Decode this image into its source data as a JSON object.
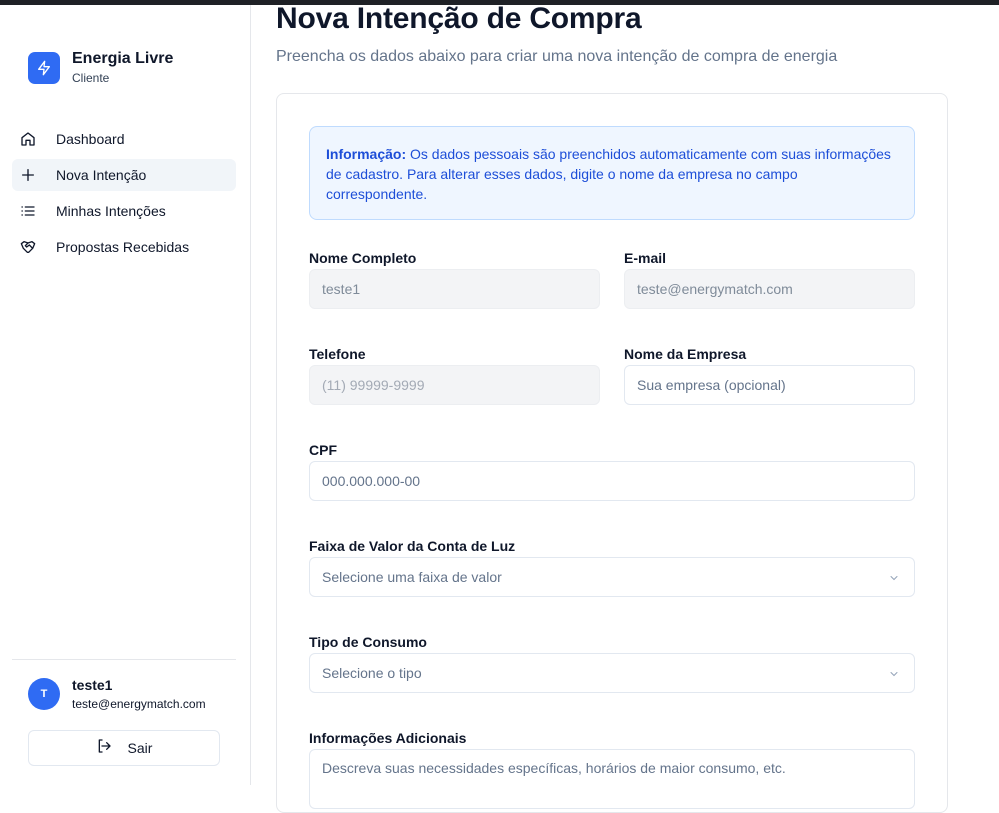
{
  "brand": {
    "name": "Energia Livre",
    "role": "Cliente",
    "logo_icon": "lightning-bolt-icon",
    "accent": "#2f6bf3"
  },
  "nav": {
    "items": [
      {
        "label": "Dashboard",
        "icon": "home-icon",
        "active": false
      },
      {
        "label": "Nova Intenção",
        "icon": "plus-icon",
        "active": true
      },
      {
        "label": "Minhas Intenções",
        "icon": "list-icon",
        "active": false
      },
      {
        "label": "Propostas Recebidas",
        "icon": "handshake-icon",
        "active": false
      }
    ]
  },
  "user": {
    "initial": "T",
    "name": "teste1",
    "email": "teste@energymatch.com",
    "logout_label": "Sair"
  },
  "page": {
    "title": "Nova Intenção de Compra",
    "subtitle": "Preencha os dados abaixo para criar uma nova intenção de compra de energia"
  },
  "info": {
    "label": "Informação:",
    "text": " Os dados pessoais são preenchidos automaticamente com suas informações de cadastro. Para alterar esses dados, digite o nome da empresa no campo correspondente."
  },
  "form": {
    "nome": {
      "label": "Nome Completo",
      "value": "teste1"
    },
    "email": {
      "label": "E-mail",
      "value": "teste@energymatch.com"
    },
    "telefone": {
      "label": "Telefone",
      "placeholder": "(11) 99999-9999"
    },
    "empresa": {
      "label": "Nome da Empresa",
      "placeholder": "Sua empresa (opcional)"
    },
    "cpf": {
      "label": "CPF",
      "placeholder": "000.000.000-00"
    },
    "faixa": {
      "label": "Faixa de Valor da Conta de Luz",
      "placeholder": "Selecione uma faixa de valor"
    },
    "tipo": {
      "label": "Tipo de Consumo",
      "placeholder": "Selecione o tipo"
    },
    "info_adicionais": {
      "label": "Informações Adicionais",
      "placeholder": "Descreva suas necessidades específicas, horários de maior consumo, etc."
    }
  }
}
